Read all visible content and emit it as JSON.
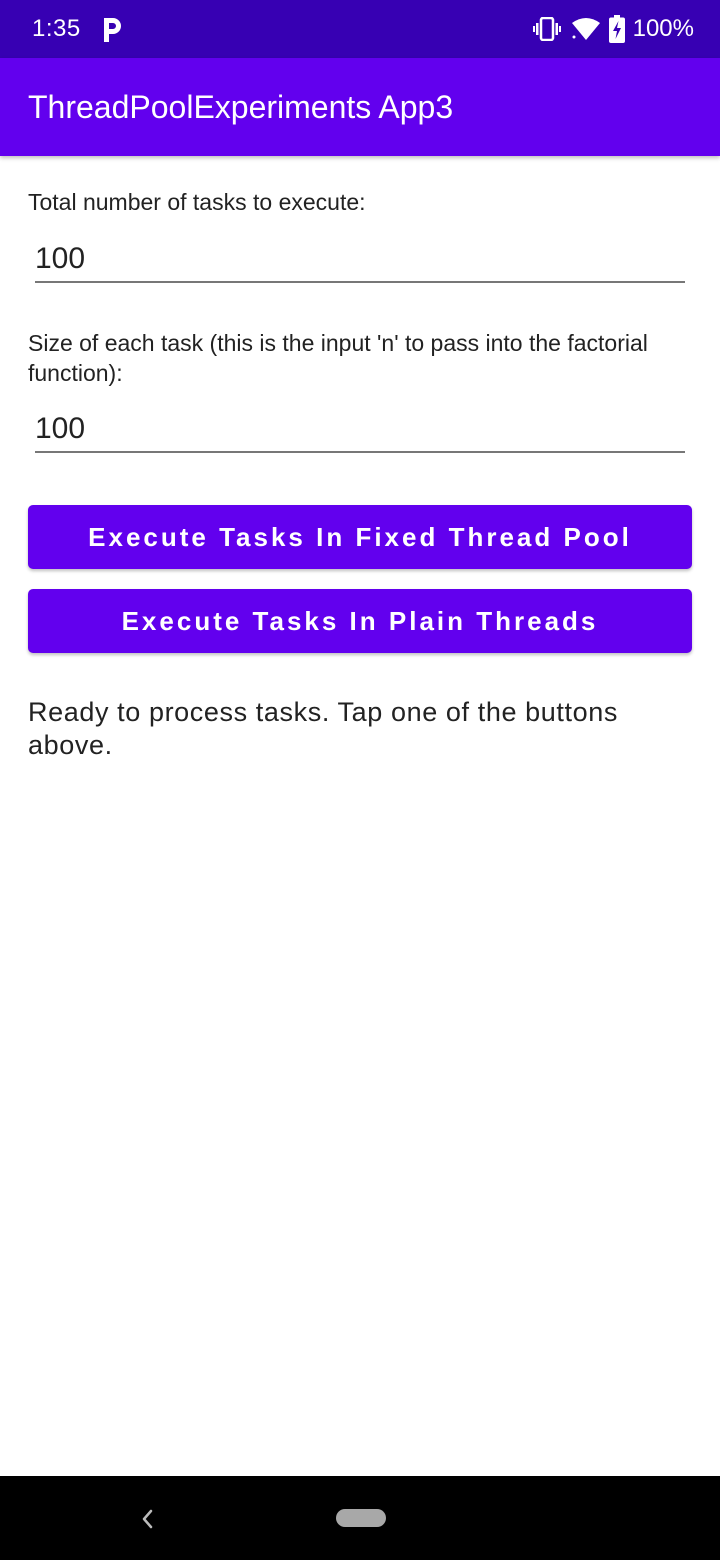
{
  "status_bar": {
    "time": "1:35",
    "notification_icon": "parking-p-icon",
    "vibrate_icon": "vibrate-icon",
    "wifi_icon": "wifi-icon",
    "battery_icon": "battery-charging-icon",
    "battery_percent": "100%"
  },
  "app_bar": {
    "title": "ThreadPoolExperiments App3"
  },
  "form": {
    "tasks_label": "Total number of tasks to execute:",
    "tasks_value": "100",
    "size_label": "Size of each task (this is the input 'n' to pass into the factorial function):",
    "size_value": "100"
  },
  "buttons": {
    "fixed_pool": "Execute Tasks In Fixed Thread Pool",
    "plain_threads": "Execute Tasks In Plain Threads"
  },
  "status_message": "Ready to process tasks. Tap one of the buttons above.",
  "nav_bar": {
    "back_icon": "back-chevron-icon",
    "home_icon": "home-pill-icon"
  },
  "colors": {
    "status_bar": "#3700b3",
    "primary": "#6200ee",
    "nav_bar": "#000000"
  }
}
